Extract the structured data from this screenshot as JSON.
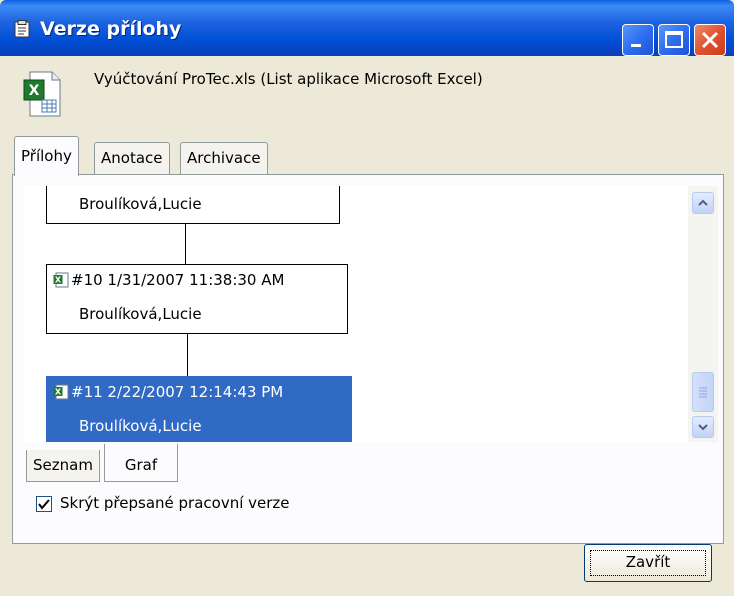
{
  "window": {
    "title": "Verze přílohy"
  },
  "file": {
    "description": "Vyúčtování ProTec.xls (List aplikace Microsoft Excel)",
    "icon": "excel-file-icon"
  },
  "tabs": [
    {
      "label": "Přílohy",
      "active": true
    },
    {
      "label": "Anotace",
      "active": false
    },
    {
      "label": "Archivace",
      "active": false
    }
  ],
  "graph": {
    "nodes": [
      {
        "header": "",
        "author": "Broulíková,Lucie",
        "selected": false
      },
      {
        "header": "#10  1/31/2007 11:38:30 AM",
        "author": "Broulíková,Lucie",
        "selected": false
      },
      {
        "header": "#11  2/22/2007 12:14:43 PM",
        "author": "Broulíková,Lucie",
        "selected": true
      }
    ]
  },
  "view_tabs": [
    {
      "label": "Seznam",
      "active": false
    },
    {
      "label": "Graf",
      "active": true
    }
  ],
  "options": {
    "hide_overwritten_label": "Skrýt přepsané pracovní verze",
    "hide_overwritten_checked": true
  },
  "buttons": {
    "close_label": "Zavřít"
  },
  "colors": {
    "title_bar": "#0a5fe6",
    "selection": "#316ac5",
    "dialog_bg": "#ece9d8"
  }
}
